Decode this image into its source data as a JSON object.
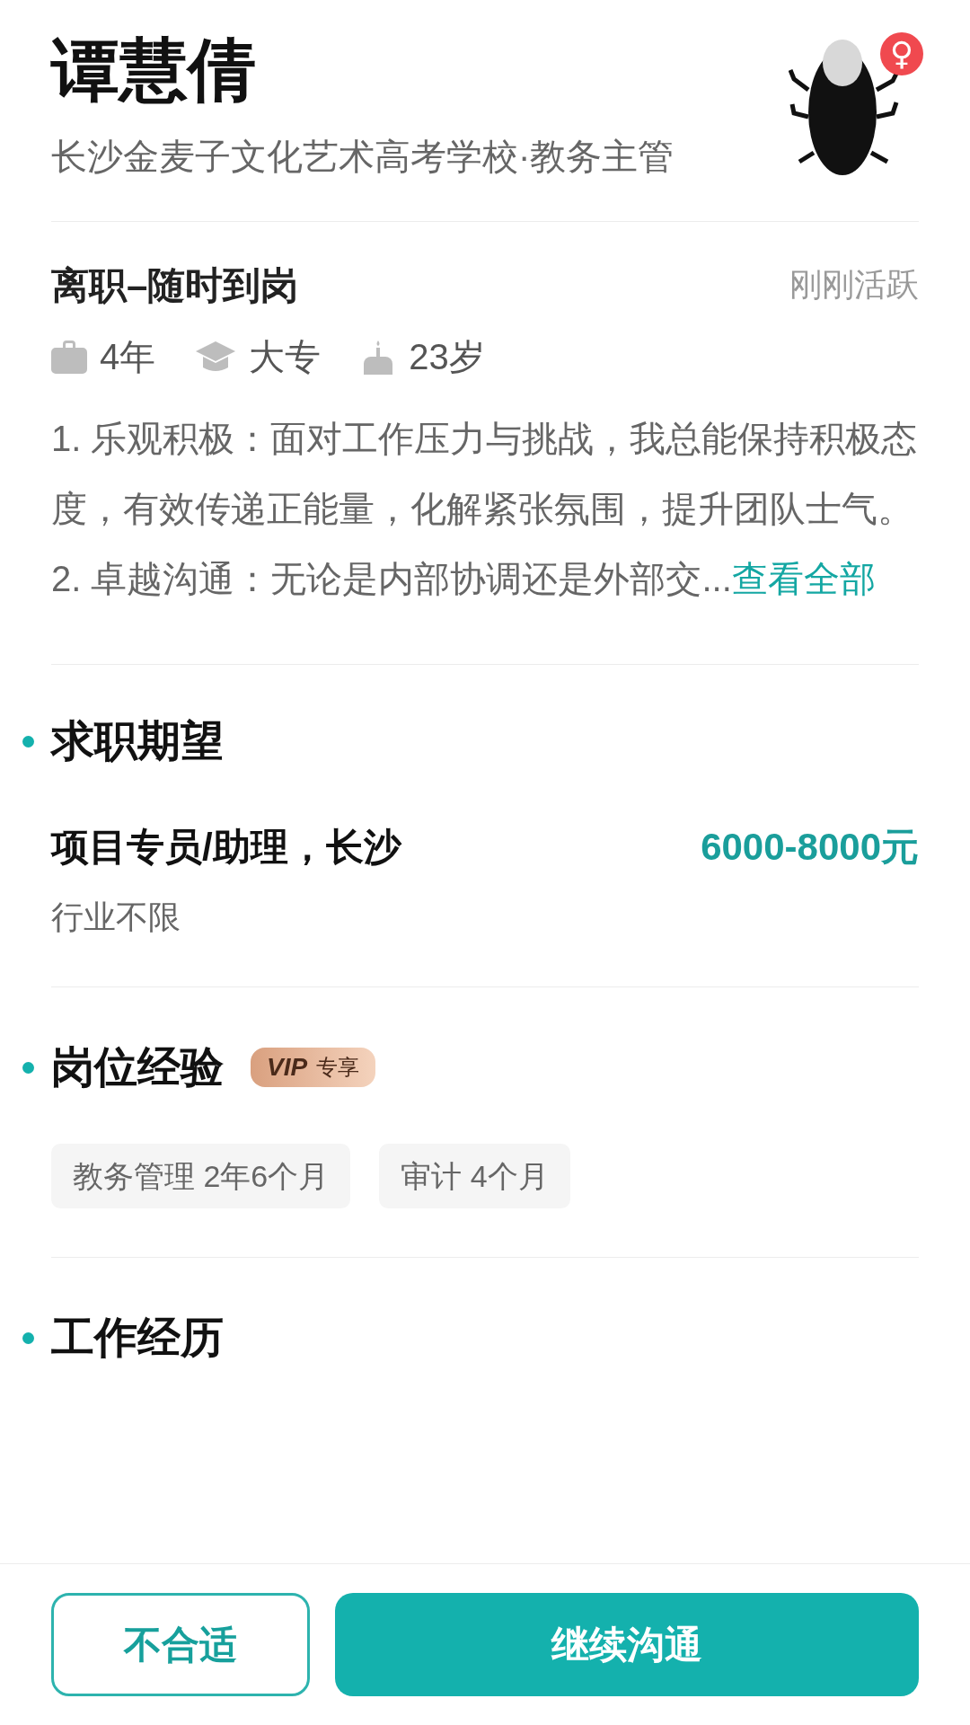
{
  "profile": {
    "name": "谭慧倩",
    "subtitle": "长沙金麦子文化艺术高考学校·教务主管",
    "gender": "♀"
  },
  "status": {
    "availability": "离职–随时到岗",
    "activity": "刚刚活跃"
  },
  "meta": [
    {
      "kind": "experience",
      "text": "4年"
    },
    {
      "kind": "education",
      "text": "大专"
    },
    {
      "kind": "age",
      "text": "23岁"
    }
  ],
  "summary": {
    "paragraphs": [
      "1. 乐观积极：面对工作压力与挑战，我总能保持积极态度，有效传递正能量，化解紧张氛围，提升团队士气。",
      "2. 卓越沟通：无论是内部协调还是外部交..."
    ],
    "more_link": "查看全部"
  },
  "expectation": {
    "title": "求职期望",
    "position": "项目专员/助理，长沙",
    "salary": "6000-8000元",
    "industry": "行业不限"
  },
  "experience": {
    "title": "岗位经验",
    "badge": {
      "mark": "VIP",
      "text": "专享"
    },
    "tags": [
      "教务管理 2年6个月",
      "审计 4个月"
    ]
  },
  "work_history": {
    "title": "工作经历"
  },
  "buttons": [
    {
      "kind": "secondary",
      "label": "不合适"
    },
    {
      "kind": "primary",
      "label": "继续沟通"
    }
  ]
}
